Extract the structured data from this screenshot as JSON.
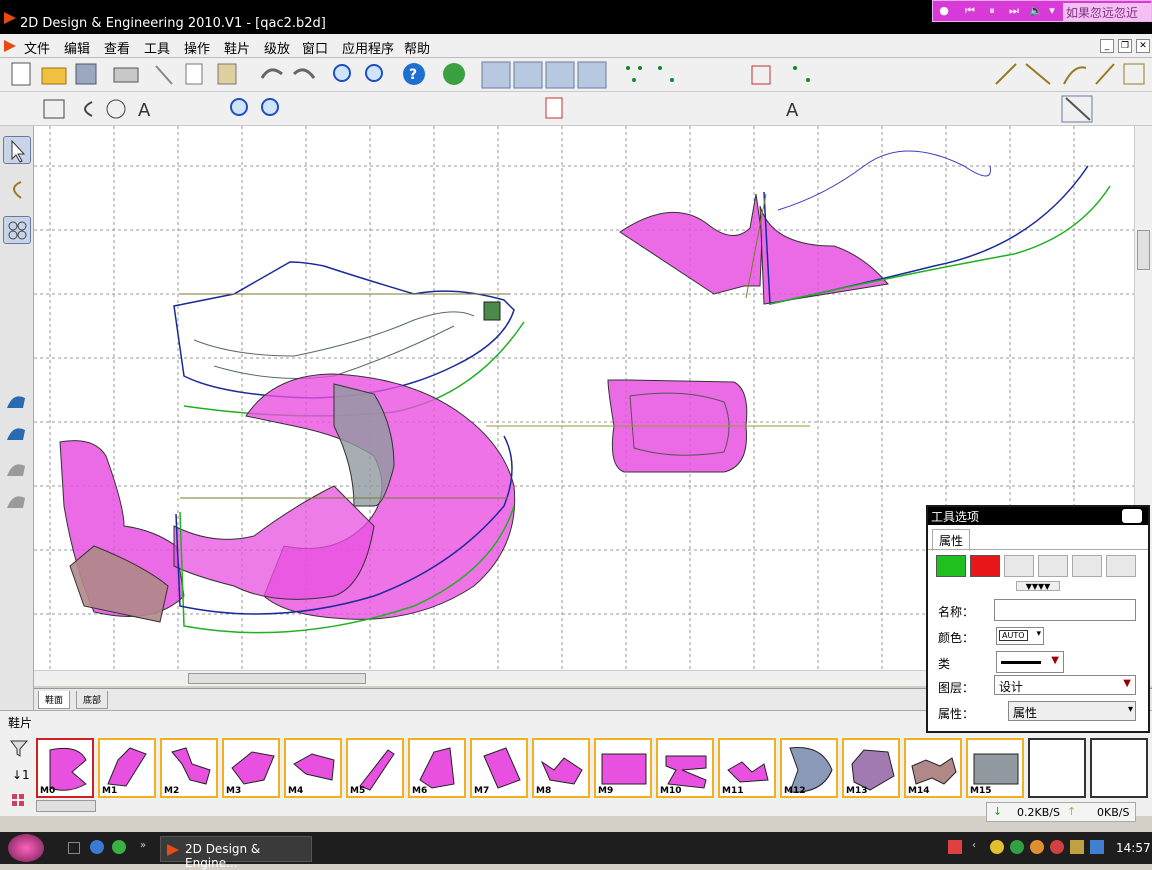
{
  "app": {
    "title": "2D Design & Engineering 2010.V1 - [qac2.b2d]",
    "menu": [
      "文件",
      "编辑",
      "查看",
      "工具",
      "操作",
      "鞋片",
      "级放",
      "窗口",
      "应用程序",
      "帮助"
    ]
  },
  "media_bar": {
    "text": "如果忽远忽近"
  },
  "canvas_tabs": [
    "鞋面",
    "底部"
  ],
  "parts_panel": {
    "title": "鞋片",
    "items": [
      {
        "label": "M0",
        "color": "#e850e0"
      },
      {
        "label": "M1",
        "color": "#e850e0"
      },
      {
        "label": "M2",
        "color": "#e850e0"
      },
      {
        "label": "M3",
        "color": "#e850e0"
      },
      {
        "label": "M4",
        "color": "#e850e0"
      },
      {
        "label": "M5",
        "color": "#e850e0"
      },
      {
        "label": "M6",
        "color": "#e850e0"
      },
      {
        "label": "M7",
        "color": "#e850e0"
      },
      {
        "label": "M8",
        "color": "#e850e0"
      },
      {
        "label": "M9",
        "color": "#e850e0"
      },
      {
        "label": "M10",
        "color": "#e850e0"
      },
      {
        "label": "M11",
        "color": "#e850e0"
      },
      {
        "label": "M12",
        "color": "#8a9ab8"
      },
      {
        "label": "M13",
        "color": "#a07ab0"
      },
      {
        "label": "M14",
        "color": "#b08888"
      },
      {
        "label": "M15",
        "color": "#909aa0"
      }
    ]
  },
  "tool_options": {
    "title": "工具选项",
    "tab": "属性",
    "name_label": "名称：",
    "name_value": "",
    "color_label": "颜色：",
    "color_value": "AUTO",
    "type_label": "类",
    "layer_label": "图层：",
    "layer_value": "设计",
    "attr_label": "属性：",
    "attr_value": "属性",
    "swatches": [
      "#20c020",
      "#e81818"
    ]
  },
  "net_status": {
    "down": "0.2KB/S",
    "up": "0KB/S"
  },
  "taskbar": {
    "task_label": "2D Design & Engine...",
    "clock": "14:57"
  },
  "colors": {
    "pattern_fill": "#e850e0",
    "grid": "#9a9a9a",
    "outline": "#1a2a9a"
  }
}
